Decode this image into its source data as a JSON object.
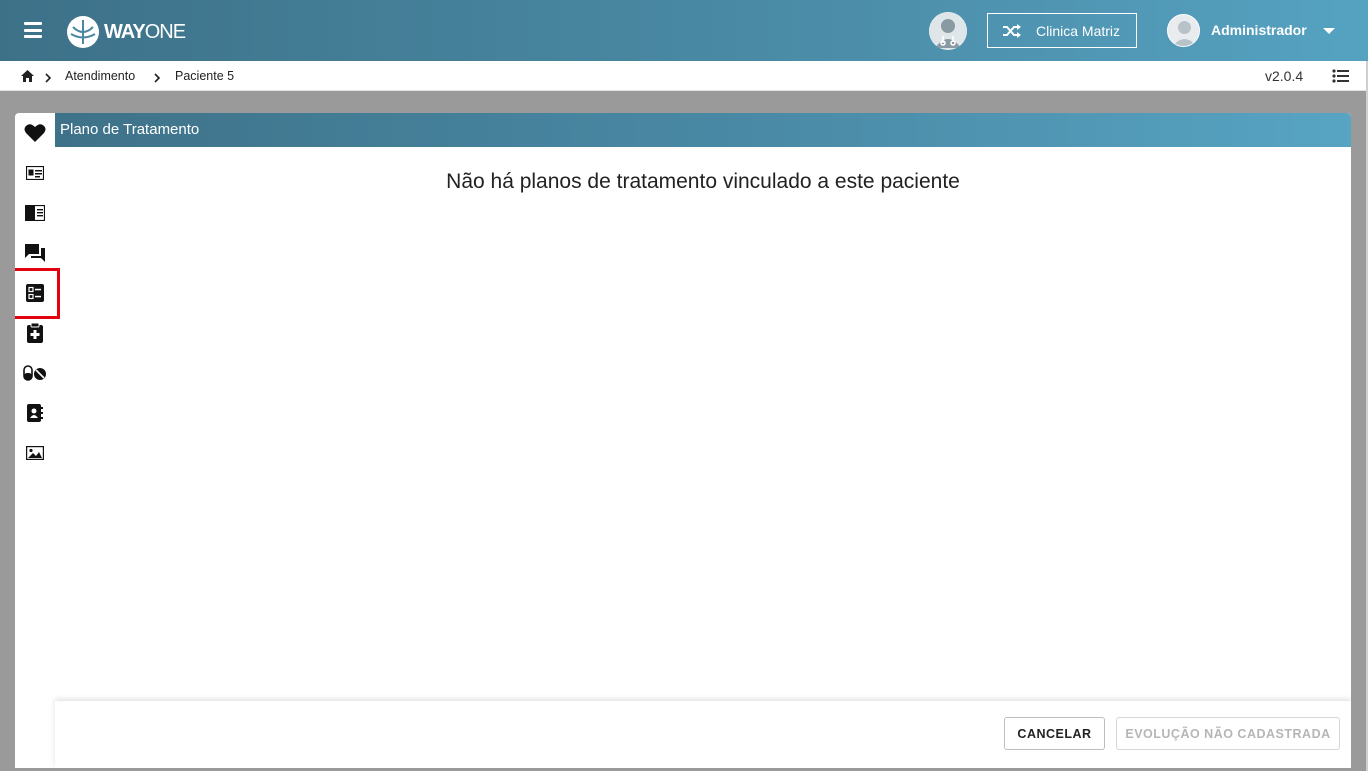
{
  "header": {
    "logo_brand_bold": "WAY",
    "logo_brand_light": "ONE",
    "clinic_label": "Clinica Matriz",
    "user_name": "Administrador"
  },
  "breadcrumb": {
    "items": [
      "Atendimento",
      "Paciente 5"
    ],
    "version": "v2.0.4"
  },
  "panel": {
    "title": "Plano de Tratamento",
    "empty_message": "Não há planos de tratamento vinculado a este paciente"
  },
  "sidebar": {
    "icons": [
      "heart-icon",
      "id-card-icon",
      "book-open-icon",
      "chat-bubbles-icon",
      "checklist-icon",
      "clipboard-medical-icon",
      "pills-icon",
      "contact-book-icon",
      "image-icon"
    ],
    "active": "checklist-icon",
    "highlight_color": "#e3000f"
  },
  "footer": {
    "cancel_label": "CANCELAR",
    "evolution_label": "EVOLUÇÃO NÃO CADASTRADA"
  },
  "colors": {
    "header_gradient_start": "#3d7188",
    "header_gradient_end": "#55a2c1",
    "backdrop": "#9a9a9a"
  }
}
